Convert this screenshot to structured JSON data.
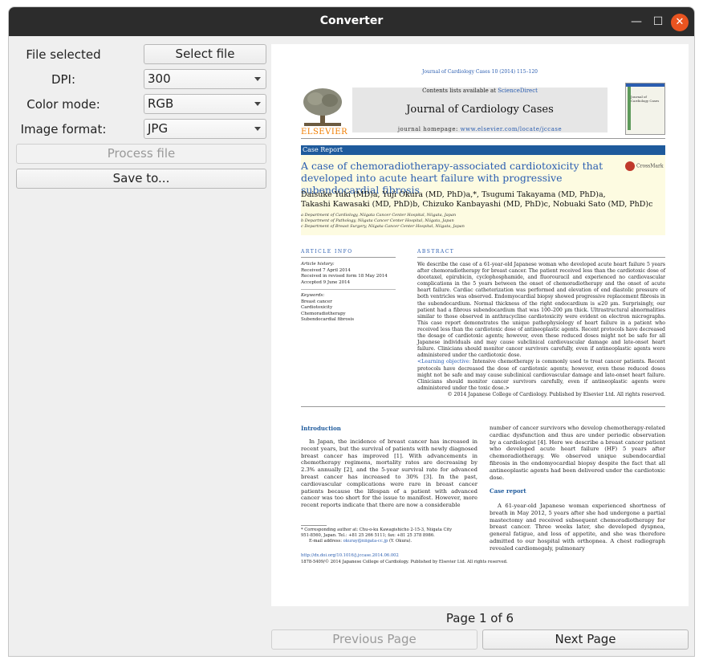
{
  "window": {
    "title": "Converter",
    "minimize_icon": "minimize-icon",
    "maximize_icon": "maximize-icon",
    "close_icon": "close-icon"
  },
  "controls": {
    "file_label": "File selected",
    "select_file_button": "Select file",
    "dpi_label": "DPI:",
    "dpi_value": "300",
    "color_mode_label": "Color mode:",
    "color_mode_value": "RGB",
    "image_format_label": "Image format:",
    "image_format_value": "JPG",
    "process_button": "Process file",
    "save_button": "Save to..."
  },
  "pagination": {
    "page_indicator": "Page 1 of 6",
    "previous_button": "Previous Page",
    "next_button": "Next Page"
  },
  "document": {
    "journal_ref": "Journal of Cardiology Cases 10 (2014) 115–120",
    "contents_prefix": "Contents lists available at ",
    "contents_link": "ScienceDirect",
    "journal_name": "Journal of Cardiology Cases",
    "homepage_prefix": "journal homepage: ",
    "homepage_url": "www.elsevier.com/locate/jccase",
    "publisher": "ELSEVIER",
    "cover_text": "Journal of Cardiology Cases",
    "article_type": "Case Report",
    "title": "A case of chemoradiotherapy-associated cardiotoxicity that developed into acute heart failure with progressive subendocardial fibrosis",
    "crossmark": "CrossMark",
    "authors_line1": "Daisuke Yuki (MD)a, Yuji Okura (MD, PhD)a,*, Tsugumi Takayama (MD, PhD)a,",
    "authors_line2": "Takashi Kawasaki (MD, PhD)b, Chizuko Kanbayashi (MD, PhD)c, Nobuaki Sato (MD, PhD)c",
    "affiliations": [
      "a Department of Cardiology, Niigata Cancer Center Hospital, Niigata, Japan",
      "b Department of Pathology, Niigata Cancer Center Hospital, Niigata, Japan",
      "c Department of Breast Surgery, Niigata Cancer Center Hospital, Niigata, Japan"
    ],
    "article_info_label": "ARTICLE INFO",
    "abstract_label": "ABSTRACT",
    "article_history_label": "Article history:",
    "history": [
      "Received 7 April 2014",
      "Received in revised form 18 May 2014",
      "Accepted 9 June 2014"
    ],
    "keywords_label": "Keywords:",
    "keywords": [
      "Breast cancer",
      "Cardiotoxicity",
      "Chemoradiotherapy",
      "Subendocardial fibrosis"
    ],
    "abstract_text": "We describe the case of a 61-year-old Japanese woman who developed acute heart failure 5 years after chemoradiotherapy for breast cancer. The patient received less than the cardiotoxic dose of docetaxel, epirubicin, cyclophosphamide, and fluorouracil and experienced no cardiovascular complications in the 5 years between the onset of chemoradiotherapy and the onset of acute heart failure. Cardiac catheterization was performed and elevation of end diastolic pressure of both ventricles was observed. Endomyocardial biopsy showed progressive replacement fibrosis in the subendocardium. Normal thickness of the right endocardium is ≤20 µm. Surprisingly, our patient had a fibrous subendocardium that was 100–200 µm thick. Ultrastructural abnormalities similar to those observed in anthracycline cardiotoxicity were evident on electron micrographs. This case report demonstrates the unique pathophysiology of heart failure in a patient who received less than the cardiotoxic dose of antineoplastic agents. Recent protocols have decreased the dosage of cardiotoxic agents; however, even these reduced doses might not be safe for all Japanese individuals and may cause subclinical cardiovascular damage and late-onset heart failure. Clinicians should monitor cancer survivors carefully, even if antineoplastic agents were administered under the cardiotoxic dose.",
    "learning_objective_label": "<Learning objective:",
    "learning_objective_text": " Intensive chemotherapy is commonly used to treat cancer patients. Recent protocols have decreased the dose of cardiotoxic agents; however, even these reduced doses might not be safe and may cause subclinical cardiovascular damage and late-onset heart failure. Clinicians should monitor cancer survivors carefully, even if antineoplastic agents were administered under the toxic dose.>",
    "copyright": "© 2014 Japanese College of Cardiology. Published by Elsevier Ltd. All rights reserved.",
    "intro_heading": "Introduction",
    "intro_text": "In Japan, the incidence of breast cancer has increased in recent years, but the survival of patients with newly diagnosed breast cancer has improved [1]. With advancements in chemotherapy regimens, mortality rates are decreasing by 2.3% annually [2], and the 5-year survival rate for advanced breast cancer has increased to 30% [3]. In the past, cardiovascular complications were rare in breast cancer patients because the lifespan of a patient with advanced cancer was too short for the issue to manifest. However, more recent reports indicate that there are now a considerable",
    "right_col_text": "number of cancer survivors who develop chemotherapy-related cardiac dysfunction and thus are under periodic observation by a cardiologist [4]. Here we describe a breast cancer patient who developed acute heart failure (HF) 5 years after chemoradiotherapy. We observed unique subendocardial fibrosis in the endomyocardial biopsy despite the fact that all antineoplastic agents had been delivered under the cardiotoxic dose.",
    "case_heading": "Case report",
    "case_text": "A 61-year-old Japanese woman experienced shortness of breath in May 2012, 5 years after she had undergone a partial mastectomy and received subsequent chemoradiotherapy for breast cancer. Three weeks later, she developed dyspnea, general fatigue, and loss of appetite, and she was therefore admitted to our hospital with orthopnea. A chest radiograph revealed cardiomegaly, pulmonary",
    "footnote_line1": "* Corresponding author at: Chu-o-ku Kawagishicho 2-15-3, Niigata City",
    "footnote_line2": "951-8560, Japan. Tel.: +81 25 266 5111; fax: +81 25 378 8986.",
    "footnote_email_prefix": "E-mail address: ",
    "footnote_email": "okuray@niigata-cc.jp",
    "footnote_email_suffix": " (Y. Okura).",
    "doi_link": "http://dx.doi.org/10.1016/j.jccase.2014.06.002",
    "issn_line": "1878-5409/© 2014 Japanese College of Cardiology. Published by Elsevier Ltd. All rights reserved."
  }
}
